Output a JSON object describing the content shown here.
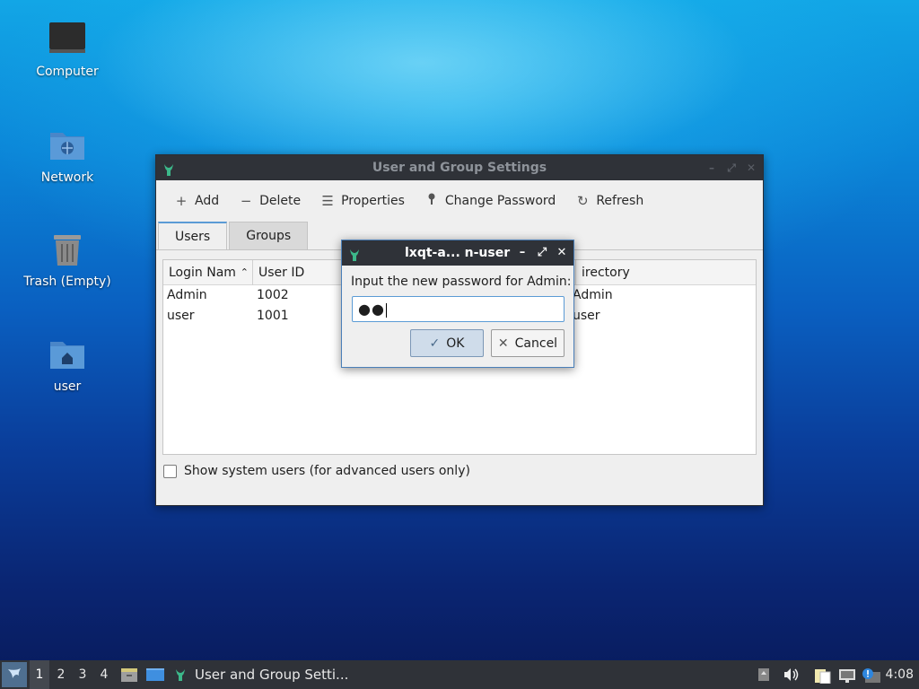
{
  "desktop": {
    "icons": [
      {
        "label": "Computer"
      },
      {
        "label": "Network"
      },
      {
        "label": "Trash (Empty)"
      },
      {
        "label": "user"
      }
    ]
  },
  "main_window": {
    "title": "User and Group Settings",
    "toolbar": {
      "add": "Add",
      "delete": "Delete",
      "properties": "Properties",
      "change_password": "Change Password",
      "refresh": "Refresh"
    },
    "tabs": [
      {
        "label": "Users",
        "active": true
      },
      {
        "label": "Groups",
        "active": false
      }
    ],
    "table": {
      "columns": [
        "Login Nam",
        "User ID",
        "Directory"
      ],
      "directory_visible": "irectory",
      "rows": [
        {
          "login": "Admin",
          "uid": "1002",
          "dir": "Admin"
        },
        {
          "login": "user",
          "uid": "1001",
          "dir": "user"
        }
      ],
      "rows_visible": [
        {
          "login": "Admin",
          "uid": "1002",
          "dir": "Admin"
        },
        {
          "login": "user",
          "uid": "1001",
          "dir": "user"
        }
      ]
    },
    "show_system_users": "Show system users (for advanced users only)"
  },
  "dialog": {
    "title": "lxqt-a... n-user",
    "prompt": "Input the new password for Admin:",
    "password_mask": "●●",
    "ok": "OK",
    "cancel": "Cancel"
  },
  "taskbar": {
    "workspaces": [
      "1",
      "2",
      "3",
      "4"
    ],
    "active_workspace": "1",
    "task_label": "User and Group Setti...",
    "clock": "4:08"
  },
  "colors": {
    "titlebar": "#2f3238",
    "accent": "#5b9bd5",
    "desktop_top": "#12a6e6",
    "desktop_bottom": "#081a5a"
  }
}
